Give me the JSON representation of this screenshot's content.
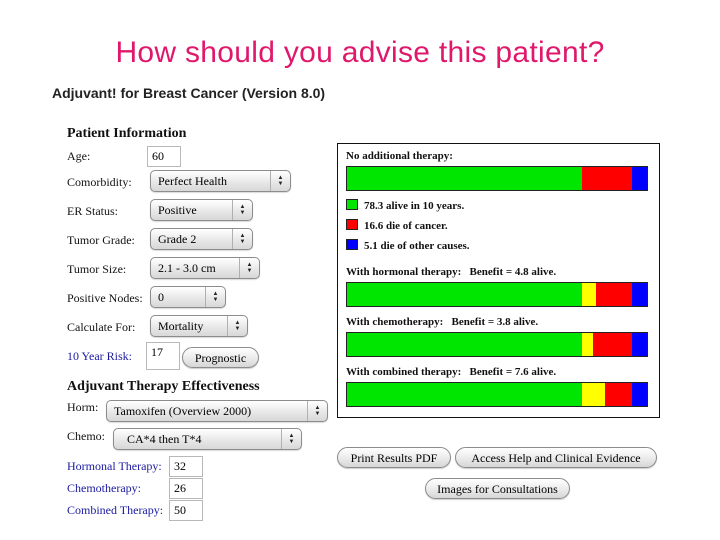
{
  "slide_title": "How should you advise this patient?",
  "app_title": "Adjuvant! for Breast Cancer (Version 8.0)",
  "colors": {
    "title": "#e0186c",
    "alive": "#00e600",
    "benefit": "#ffff00",
    "cancer": "#ff0000",
    "other": "#0000ff",
    "blue_label": "#1a1aa0"
  },
  "patient_info": {
    "heading": "Patient Information",
    "age": {
      "label": "Age:",
      "value": "60"
    },
    "comorbidity": {
      "label": "Comorbidity:",
      "value": "Perfect Health"
    },
    "er_status": {
      "label": "ER Status:",
      "value": "Positive"
    },
    "tumor_grade": {
      "label": "Tumor Grade:",
      "value": "Grade 2"
    },
    "tumor_size": {
      "label": "Tumor Size:",
      "value": "2.1 - 3.0 cm"
    },
    "positive_nodes": {
      "label": "Positive Nodes:",
      "value": "0"
    },
    "calculate_for": {
      "label": "Calculate For:",
      "value": "Mortality"
    },
    "ten_year_risk": {
      "label": "10 Year Risk:",
      "value": "17"
    },
    "prognostic_button": "Prognostic"
  },
  "therapy_effectiveness": {
    "heading": "Adjuvant Therapy Effectiveness",
    "horm": {
      "label": "Horm:",
      "value": "Tamoxifen (Overview 2000)"
    },
    "chemo": {
      "label": "Chemo:",
      "value": "CA*4 then T*4"
    },
    "hormonal_therapy": {
      "label": "Hormonal Therapy:",
      "value": "32"
    },
    "chemotherapy": {
      "label": "Chemotherapy:",
      "value": "26"
    },
    "combined_therapy": {
      "label": "Combined Therapy:",
      "value": "50"
    }
  },
  "results": {
    "no_therapy": {
      "label": "No additional therapy:",
      "alive": 78.3,
      "benefit": 0,
      "cancer": 16.6,
      "other": 5.1
    },
    "legend": [
      {
        "key": "alive",
        "text": "78.3 alive in 10 years."
      },
      {
        "key": "cancer",
        "text": "16.6 die of cancer."
      },
      {
        "key": "other",
        "text": "5.1 die of other causes."
      }
    ],
    "hormonal": {
      "label": "With hormonal therapy:   Benefit = 4.8 alive.",
      "alive": 78.3,
      "benefit": 4.8,
      "cancer": 11.8,
      "other": 5.1
    },
    "chemo": {
      "label": "With chemotherapy:   Benefit = 3.8 alive.",
      "alive": 78.3,
      "benefit": 3.8,
      "cancer": 12.8,
      "other": 5.1
    },
    "combined": {
      "label": "With combined therapy:   Benefit = 7.6 alive.",
      "alive": 78.3,
      "benefit": 7.6,
      "cancer": 9.0,
      "other": 5.1
    }
  },
  "buttons": {
    "print_pdf": "Print Results PDF",
    "help": "Access Help and Clinical Evidence",
    "images": "Images for Consultations"
  }
}
